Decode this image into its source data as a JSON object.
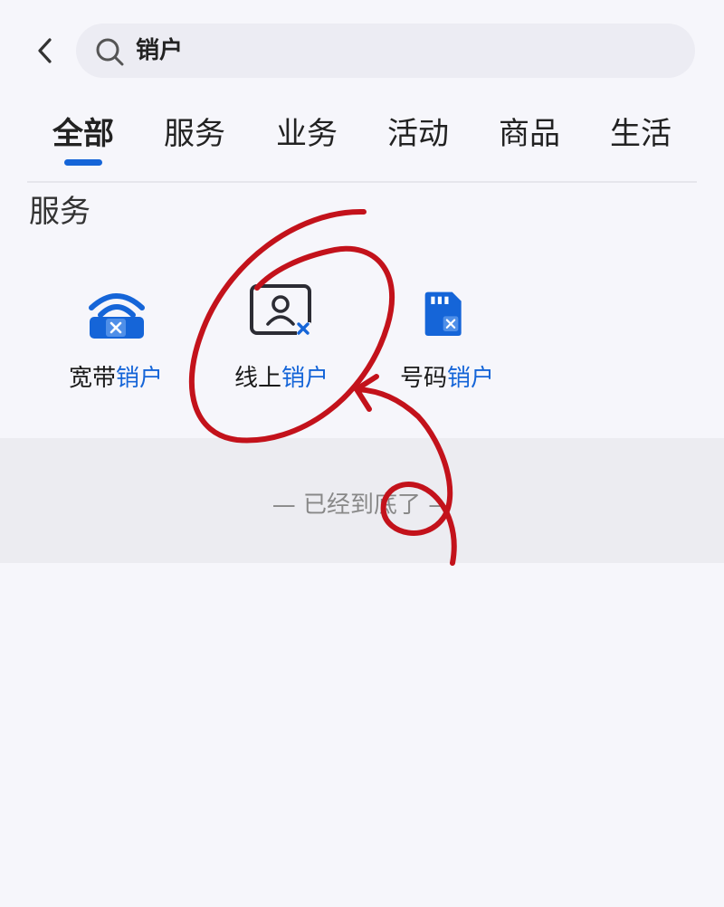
{
  "search": {
    "query": "销户"
  },
  "tabs": [
    {
      "label": "全部",
      "active": true
    },
    {
      "label": "服务",
      "active": false
    },
    {
      "label": "业务",
      "active": false
    },
    {
      "label": "活动",
      "active": false
    },
    {
      "label": "商品",
      "active": false
    },
    {
      "label": "生活",
      "active": false
    }
  ],
  "section": {
    "title": "服务",
    "items": [
      {
        "prefix": "宽带",
        "highlight": "销户",
        "icon": "broadband-cancel-icon"
      },
      {
        "prefix": "线上",
        "highlight": "销户",
        "icon": "online-id-cancel-icon"
      },
      {
        "prefix": "号码",
        "highlight": "销户",
        "icon": "sim-card-cancel-icon"
      }
    ]
  },
  "footer": {
    "end_text": "— 已经到底了 —"
  },
  "colors": {
    "accent": "#1565d8",
    "annotation": "#c3121b"
  }
}
